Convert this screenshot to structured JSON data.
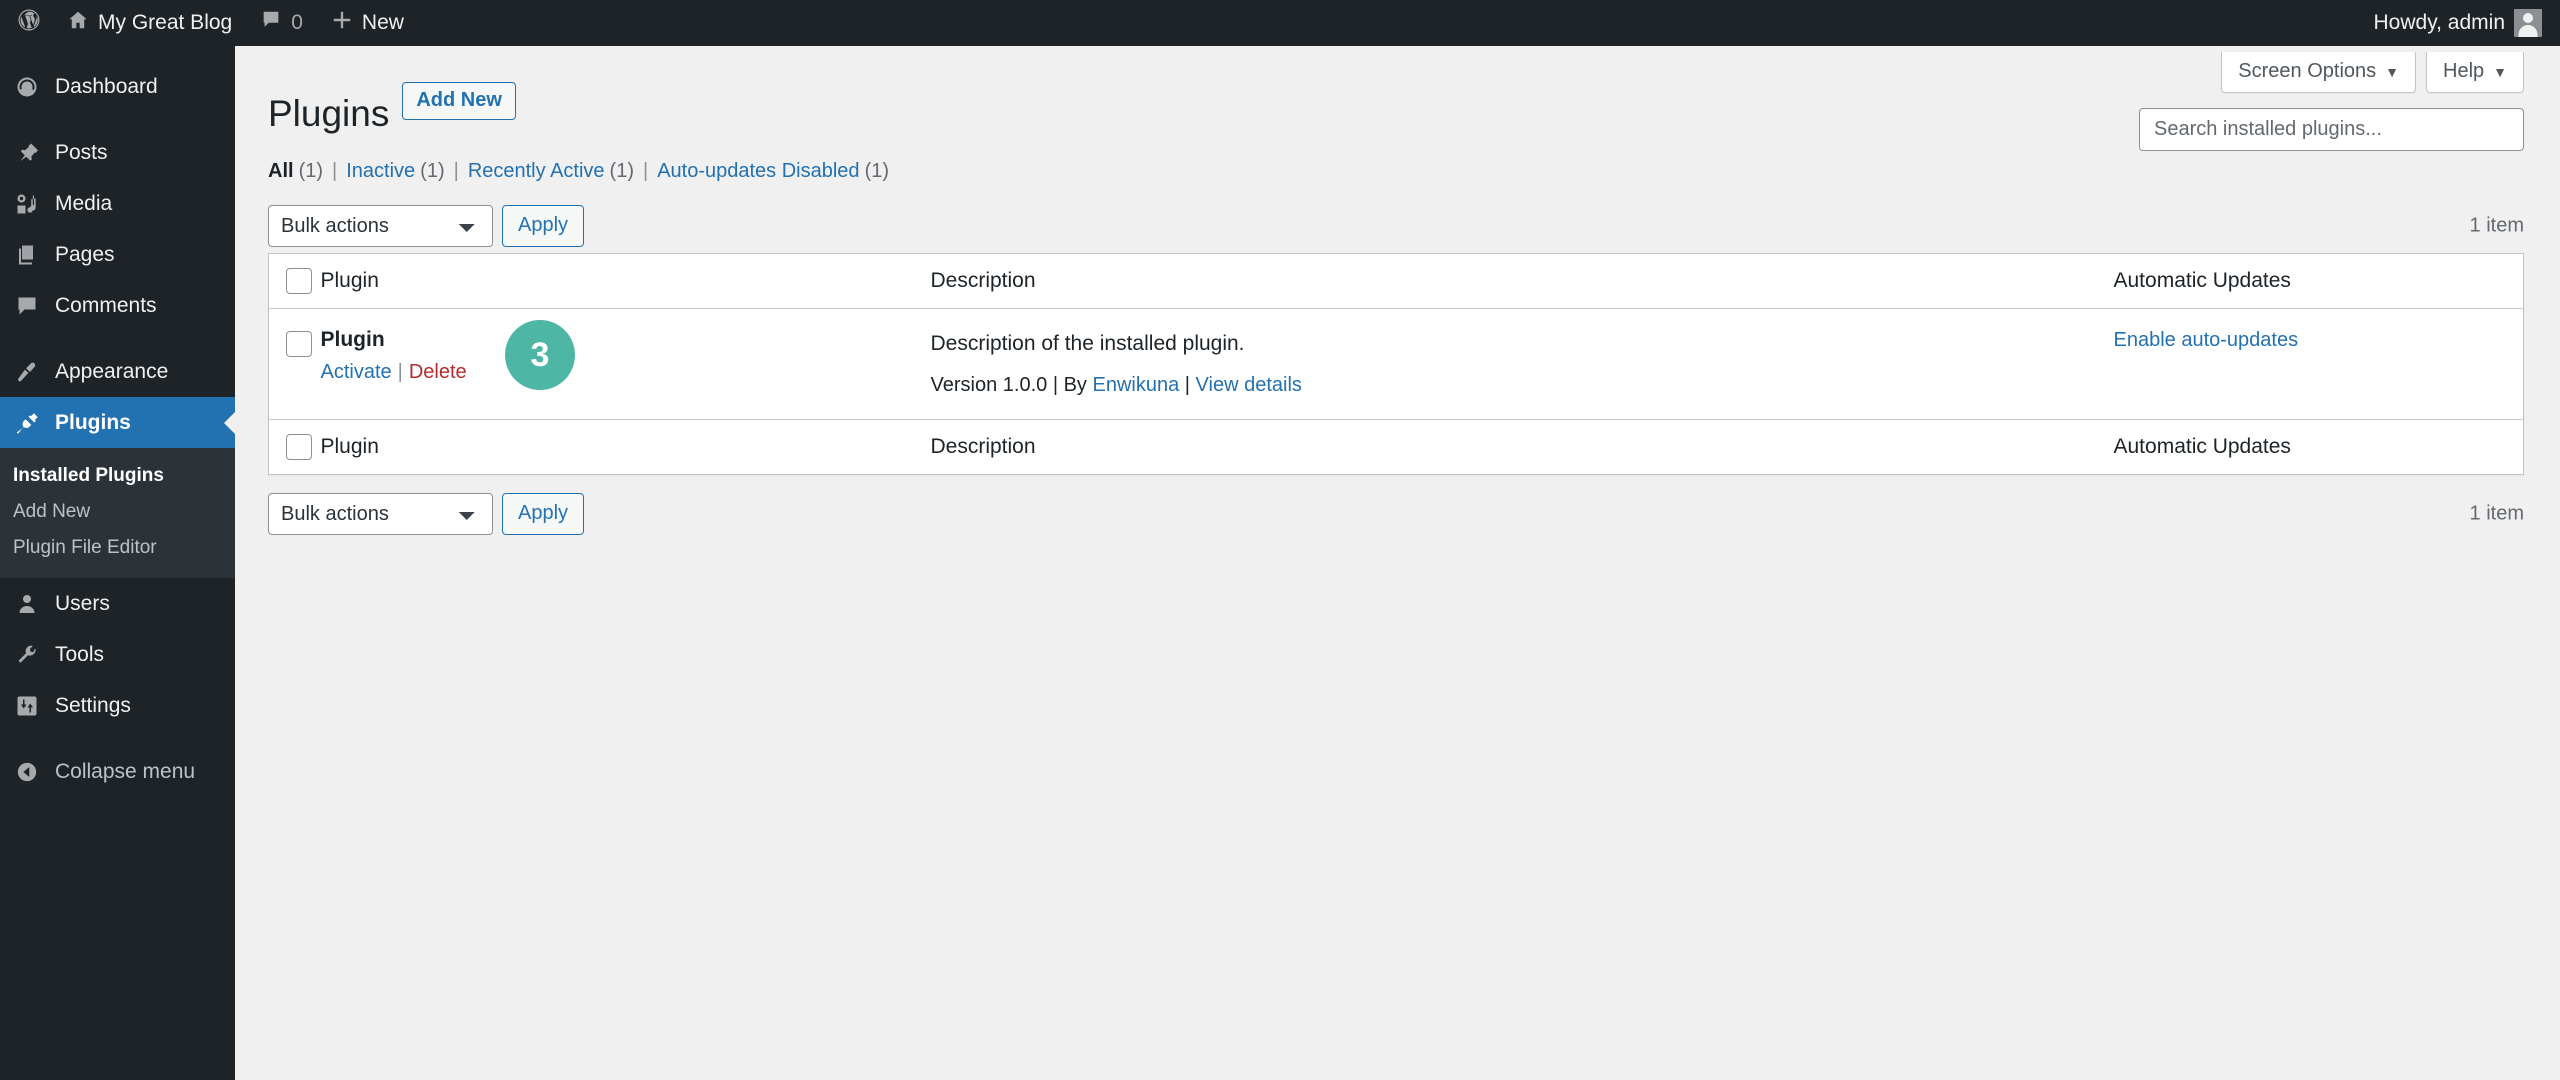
{
  "adminbar": {
    "logo_icon": "wordpress-logo-icon",
    "site_name": "My Great Blog",
    "home_icon": "home-icon",
    "comments_icon": "comment-bubble-icon",
    "comments_count": "0",
    "new_icon": "plus-icon",
    "new_label": "New",
    "howdy": "Howdy, admin"
  },
  "sidebar": {
    "items": [
      {
        "label": "Dashboard",
        "icon": "dashboard-gauge-icon",
        "name": "dashboard"
      },
      {
        "label": "Posts",
        "icon": "pin-icon",
        "name": "posts"
      },
      {
        "label": "Media",
        "icon": "media-icon",
        "name": "media"
      },
      {
        "label": "Pages",
        "icon": "pages-icon",
        "name": "pages"
      },
      {
        "label": "Comments",
        "icon": "comment-bubble-icon",
        "name": "comments"
      },
      {
        "label": "Appearance",
        "icon": "paintbrush-icon",
        "name": "appearance"
      },
      {
        "label": "Plugins",
        "icon": "plug-icon",
        "name": "plugins"
      },
      {
        "label": "Users",
        "icon": "user-icon",
        "name": "users"
      },
      {
        "label": "Tools",
        "icon": "wrench-icon",
        "name": "tools"
      },
      {
        "label": "Settings",
        "icon": "settings-sliders-icon",
        "name": "settings"
      }
    ],
    "submenu": [
      {
        "label": "Installed Plugins",
        "current": true
      },
      {
        "label": "Add New",
        "current": false
      },
      {
        "label": "Plugin File Editor",
        "current": false
      }
    ],
    "collapse_label": "Collapse menu",
    "collapse_icon": "chevron-left-circle-icon"
  },
  "screen_meta": {
    "screen_options": "Screen Options",
    "help": "Help",
    "caret": "▼"
  },
  "header": {
    "title": "Plugins",
    "add_new": "Add New"
  },
  "filters": [
    {
      "label": "All",
      "count": "(1)",
      "current": true
    },
    {
      "label": "Inactive",
      "count": "(1)",
      "current": false
    },
    {
      "label": "Recently Active",
      "count": "(1)",
      "current": false
    },
    {
      "label": "Auto-updates Disabled",
      "count": "(1)",
      "current": false
    }
  ],
  "filter_divider": "|",
  "search": {
    "value": "",
    "placeholder": "Search installed plugins..."
  },
  "tablenav": {
    "bulk_selected": "Bulk actions",
    "apply": "Apply",
    "displaying_num": "1 item"
  },
  "table": {
    "columns": {
      "plugin": "Plugin",
      "description": "Description",
      "automatic_updates": "Automatic Updates"
    },
    "rows": [
      {
        "name": "Plugin",
        "actions": {
          "activate": "Activate",
          "separator": "|",
          "delete": "Delete"
        },
        "description": "Description of the installed plugin.",
        "version_prefix": "Version 1.0.0",
        "pipe1": "|",
        "by_label": "By",
        "author": "Enwikuna",
        "pipe2": "|",
        "view_details": "View details",
        "auto_updates": "Enable auto-updates"
      }
    ]
  },
  "annotation": {
    "step_number": "3",
    "color": "#4db6a4"
  }
}
